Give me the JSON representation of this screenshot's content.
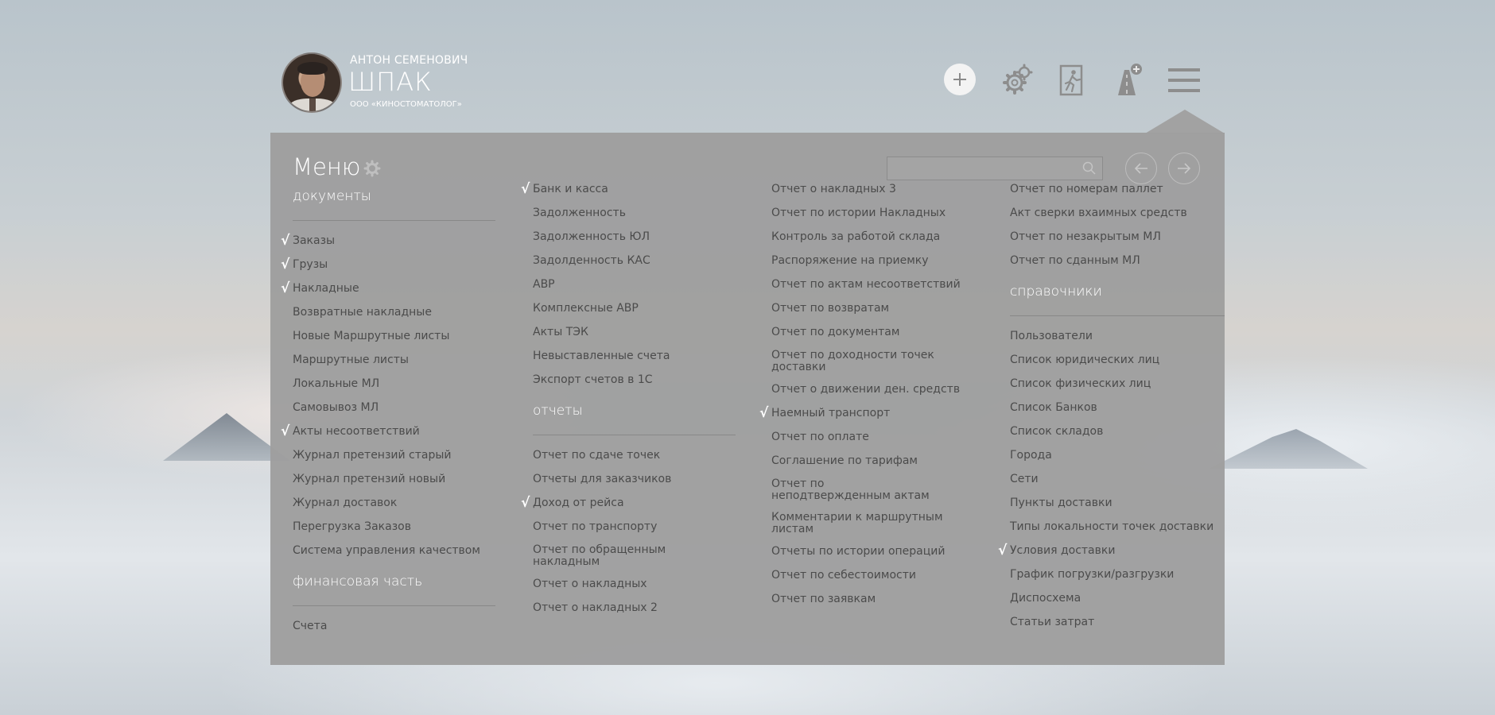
{
  "user": {
    "first_name": "АНТОН СЕМЕНОВИЧ",
    "last_name": "ШПАК",
    "org": "ООО «КИНОСТОМАТОЛОГ»"
  },
  "header_icons": [
    "plus-icon",
    "gear-icon",
    "exit-icon",
    "road-add-icon",
    "hamburger-icon"
  ],
  "menu": {
    "title": "Меню",
    "search_placeholder": "",
    "check_mark": "√"
  },
  "columns": [
    {
      "blocks": [
        {
          "section": "документы",
          "items": [
            {
              "label": "Заказы",
              "checked": true
            },
            {
              "label": "Грузы",
              "checked": true
            },
            {
              "label": "Накладные",
              "checked": true
            },
            {
              "label": "Возвратные накладные",
              "checked": false
            },
            {
              "label": "Новые Маршрутные листы",
              "checked": false
            },
            {
              "label": "Маршрутные листы",
              "checked": false
            },
            {
              "label": "Локальные МЛ",
              "checked": false
            },
            {
              "label": "Самовывоз МЛ",
              "checked": false
            },
            {
              "label": "Акты несоответствий",
              "checked": true
            },
            {
              "label": "Журнал претензий старый",
              "checked": false
            },
            {
              "label": "Журнал претензий новый",
              "checked": false
            },
            {
              "label": "Журнал доставок",
              "checked": false
            },
            {
              "label": "Перегрузка Заказов",
              "checked": false
            },
            {
              "label": "Система управления качеством",
              "checked": false
            }
          ]
        },
        {
          "section": "финансовая часть",
          "items": [
            {
              "label": "Счета",
              "checked": false
            }
          ]
        }
      ]
    },
    {
      "blocks": [
        {
          "section": null,
          "items": [
            {
              "label": "Банк и касса",
              "checked": true
            },
            {
              "label": "Задолженность",
              "checked": false
            },
            {
              "label": "Задолженность ЮЛ",
              "checked": false
            },
            {
              "label": "Задолденность КАС",
              "checked": false
            },
            {
              "label": "АВР",
              "checked": false
            },
            {
              "label": "Комплексные АВР",
              "checked": false
            },
            {
              "label": "Акты ТЭК",
              "checked": false
            },
            {
              "label": "Невыставленные счета",
              "checked": false
            },
            {
              "label": "Экспорт счетов в 1С",
              "checked": false
            }
          ]
        },
        {
          "section": "отчеты",
          "items": [
            {
              "label": "Отчет по сдаче точек",
              "checked": false
            },
            {
              "label": "Отчеты для заказчиков",
              "checked": false
            },
            {
              "label": "Доход от рейса",
              "checked": true
            },
            {
              "label": "Отчет по транспорту",
              "checked": false
            },
            {
              "label": "Отчет по обращенным накладным",
              "checked": false,
              "wrap": true
            },
            {
              "label": "Отчет о накладных",
              "checked": false
            },
            {
              "label": "Отчет о накладных 2",
              "checked": false
            }
          ]
        }
      ]
    },
    {
      "blocks": [
        {
          "section": null,
          "items": [
            {
              "label": "Отчет о накладных 3",
              "checked": false
            },
            {
              "label": "Отчет по истории Накладных",
              "checked": false
            },
            {
              "label": "Контроль за работой склада",
              "checked": false
            },
            {
              "label": "Распоряжение на приемку",
              "checked": false
            },
            {
              "label": "Отчет по актам несоответствий",
              "checked": false
            },
            {
              "label": "Отчет по возвратам",
              "checked": false
            },
            {
              "label": "Отчет по документам",
              "checked": false
            },
            {
              "label": "Отчет по доходности точек доставки",
              "checked": false,
              "wrap": true
            },
            {
              "label": "Отчет о движении ден. средств",
              "checked": false
            },
            {
              "label": "Наемный транспорт",
              "checked": true
            },
            {
              "label": "Отчет по оплате",
              "checked": false
            },
            {
              "label": "Соглашение по тарифам",
              "checked": false
            },
            {
              "label": "Отчет по неподтвержденным актам",
              "checked": false,
              "wrap": true
            },
            {
              "label": "Комментарии к маршрутным листам",
              "checked": false,
              "wrap": true
            },
            {
              "label": "Отчеты по истории операций",
              "checked": false
            },
            {
              "label": "Отчет по себестоимости",
              "checked": false
            },
            {
              "label": "Отчет по заявкам",
              "checked": false
            }
          ]
        }
      ]
    },
    {
      "blocks": [
        {
          "section": null,
          "items": [
            {
              "label": "Отчет по номерам паллет",
              "checked": false
            },
            {
              "label": "Акт сверки вхаимных средств",
              "checked": false
            },
            {
              "label": "Отчет по незакрытым МЛ",
              "checked": false
            },
            {
              "label": "Отчет по сданным МЛ",
              "checked": false
            }
          ]
        },
        {
          "section": "справочники",
          "items": [
            {
              "label": "Пользователи",
              "checked": false
            },
            {
              "label": "Список юридических лиц",
              "checked": false
            },
            {
              "label": "Список физических лиц",
              "checked": false
            },
            {
              "label": "Список Банков",
              "checked": false
            },
            {
              "label": "Список складов",
              "checked": false
            },
            {
              "label": "Города",
              "checked": false
            },
            {
              "label": "Сети",
              "checked": false
            },
            {
              "label": "Пункты доставки",
              "checked": false
            },
            {
              "label": "Типы локальности точек доставки",
              "checked": false
            },
            {
              "label": "Условия доставки",
              "checked": true
            },
            {
              "label": "График погрузки/разгрузки",
              "checked": false
            },
            {
              "label": "Диспосхема",
              "checked": false
            },
            {
              "label": "Статьи затрат",
              "checked": false
            }
          ]
        }
      ]
    }
  ]
}
